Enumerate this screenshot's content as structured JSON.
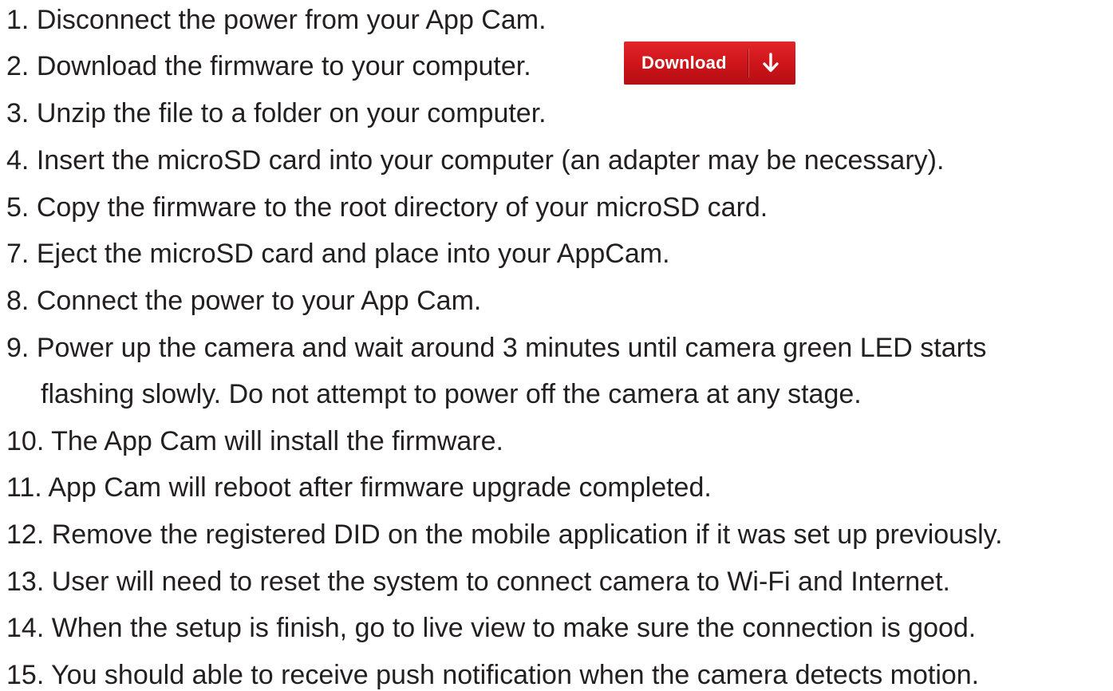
{
  "steps": [
    {
      "num": "1.",
      "text": "Disconnect the power from your App Cam."
    },
    {
      "num": "2.",
      "text": "Download the firmware to your computer."
    },
    {
      "num": "3.",
      "text": "Unzip the file to a folder on your computer."
    },
    {
      "num": "4.",
      "text": "Insert the microSD card into your computer (an adapter may be necessary)."
    },
    {
      "num": "5.",
      "text": "Copy the firmware to the root directory of your microSD card."
    },
    {
      "num": "7.",
      "text": "Eject the microSD card and place into your AppCam."
    },
    {
      "num": "8.",
      "text": "Connect the power to your App Cam."
    },
    {
      "num": "9.",
      "text": "Power up the camera and wait around 3 minutes until camera green LED starts",
      "text_cont": "flashing slowly. Do not attempt to power off the camera at any stage."
    },
    {
      "num": "10.",
      "text": "The App Cam will install the firmware."
    },
    {
      "num": "11.",
      "text": "App Cam will reboot after firmware upgrade completed."
    },
    {
      "num": "12.",
      "text": "Remove the registered DID on the mobile application if it was set up previously."
    },
    {
      "num": "13.",
      "text": "User will need to reset the system to connect camera to Wi-Fi and Internet."
    },
    {
      "num": "14.",
      "text": "When the setup is finish, go to live view to make sure the connection is good."
    },
    {
      "num": "15.",
      "text": "You should able to receive push notification when the camera detects motion."
    }
  ],
  "download_button": {
    "label": "Download",
    "icon": "arrow-down-icon",
    "color": "#d71920"
  }
}
